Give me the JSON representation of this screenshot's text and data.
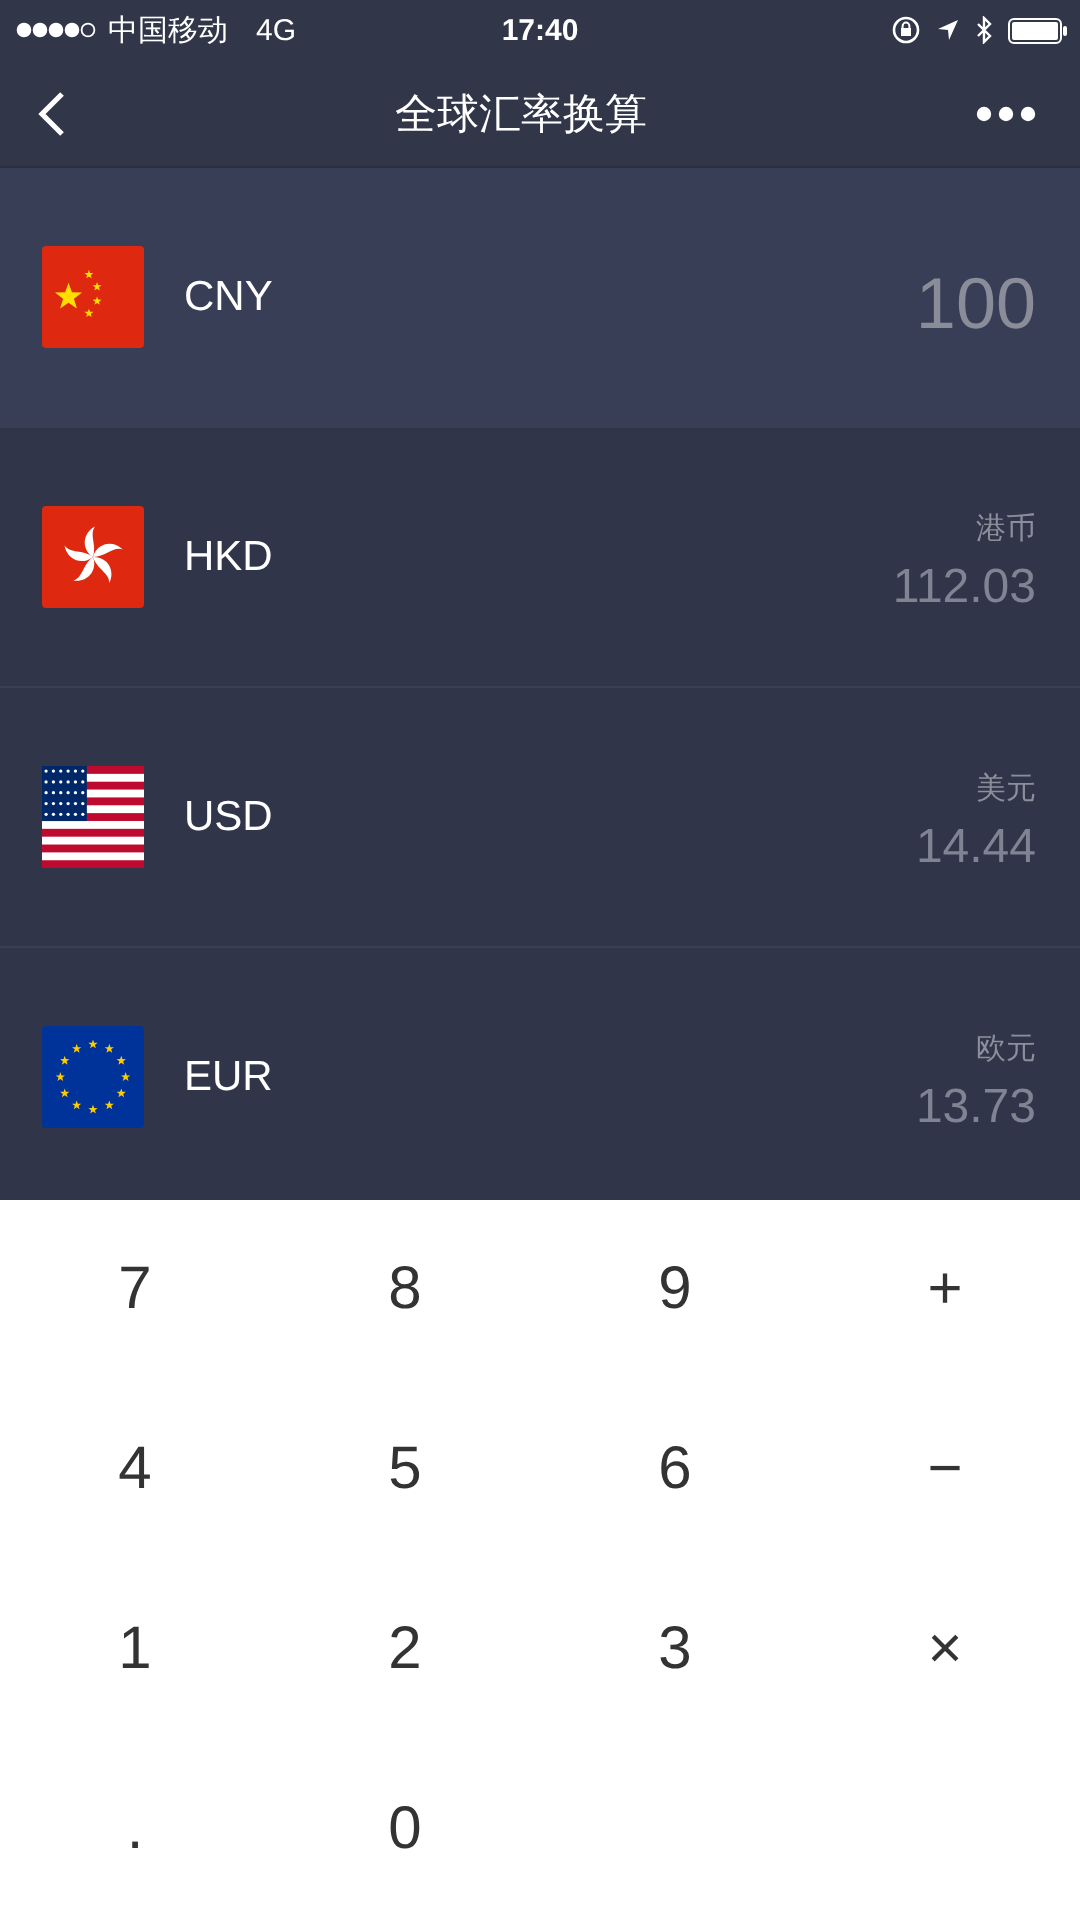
{
  "status_bar": {
    "carrier": "中国移动",
    "network": "4G",
    "time": "17:40"
  },
  "nav": {
    "title": "全球汇率换算"
  },
  "currencies": [
    {
      "kind": "cn",
      "code": "CNY",
      "amount": "100",
      "selected": true
    },
    {
      "kind": "hk",
      "code": "HKD",
      "name": "港币",
      "amount": "112.03",
      "selected": false
    },
    {
      "kind": "us",
      "code": "USD",
      "name": "美元",
      "amount": "14.44",
      "selected": false
    },
    {
      "kind": "eu",
      "code": "EUR",
      "name": "欧元",
      "amount": "13.73",
      "selected": false
    }
  ],
  "keypad": [
    [
      "7",
      "8",
      "9",
      "+"
    ],
    [
      "4",
      "5",
      "6",
      "−"
    ],
    [
      "1",
      "2",
      "3",
      "×"
    ],
    [
      ".",
      "0"
    ]
  ]
}
